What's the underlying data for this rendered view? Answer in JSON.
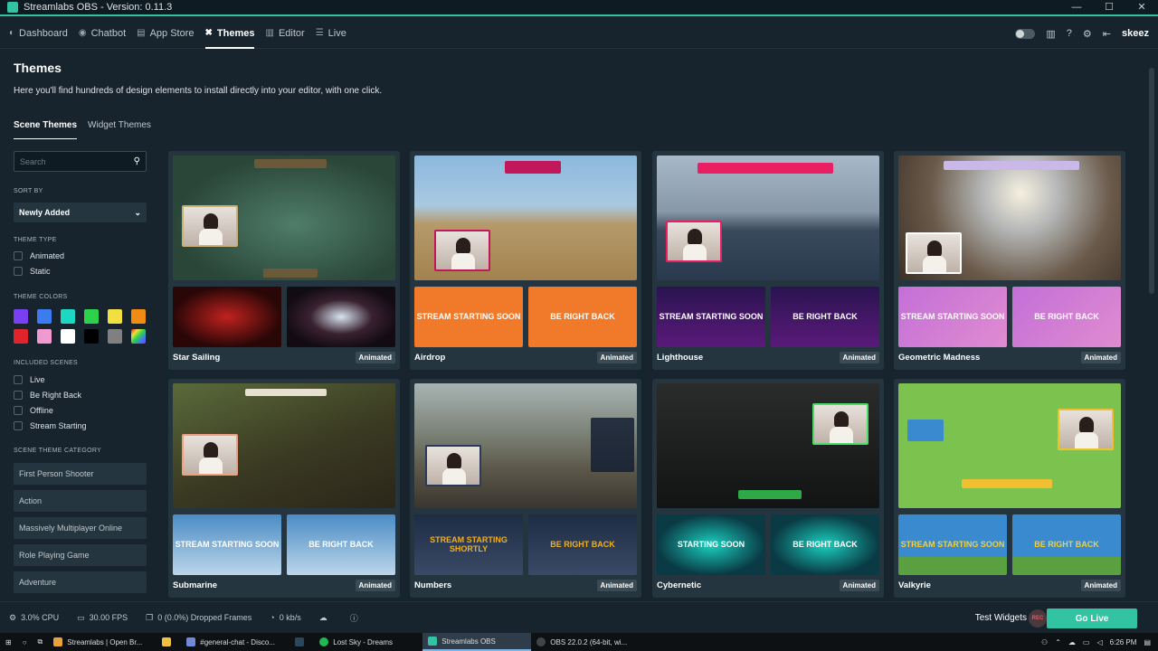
{
  "window": {
    "title": "Streamlabs OBS - Version: 0.11.3",
    "controls": [
      "—",
      "☐",
      "✕"
    ]
  },
  "nav": {
    "items": [
      {
        "label": "Dashboard",
        "icon": "dashboard-icon",
        "glyph": "◐"
      },
      {
        "label": "Chatbot",
        "icon": "chatbot-icon",
        "glyph": "◉"
      },
      {
        "label": "App Store",
        "icon": "store-icon",
        "glyph": "▤"
      },
      {
        "label": "Themes",
        "icon": "themes-icon",
        "glyph": "✖",
        "active": true
      },
      {
        "label": "Editor",
        "icon": "editor-icon",
        "glyph": "▥"
      },
      {
        "label": "Live",
        "icon": "live-icon",
        "glyph": "☰"
      }
    ],
    "user": "skeez"
  },
  "page": {
    "title": "Themes",
    "description": "Here you'll find hundreds of design elements to install directly into your editor, with one click.",
    "tabs": [
      "Scene Themes",
      "Widget Themes"
    ]
  },
  "sidebar": {
    "search_placeholder": "Search",
    "sort_label": "SORT BY",
    "sort_value": "Newly Added",
    "type_label": "THEME TYPE",
    "types": [
      "Animated",
      "Static"
    ],
    "colors_label": "THEME COLORS",
    "colors": [
      "#7b3ff2",
      "#3d7bf0",
      "#1ed7c1",
      "#2ed14a",
      "#f0e040",
      "#f08c14",
      "#e0242c",
      "#f09ad0",
      "#ffffff",
      "#000000",
      "#808080",
      "rainbow"
    ],
    "scenes_label": "INCLUDED SCENES",
    "scenes": [
      "Live",
      "Be Right Back",
      "Offline",
      "Stream Starting"
    ],
    "category_label": "SCENE THEME CATEGORY",
    "categories": [
      "First Person Shooter",
      "Action",
      "Massively Multiplayer Online",
      "Role Playing Game",
      "Adventure"
    ]
  },
  "themes": [
    {
      "name": "Star Sailing",
      "badge": "Animated",
      "thumbs": [
        "",
        ""
      ]
    },
    {
      "name": "Airdrop",
      "badge": "Animated",
      "thumbs": [
        "STREAM STARTING SOON",
        "BE RIGHT BACK"
      ]
    },
    {
      "name": "Lighthouse",
      "badge": "Animated",
      "thumbs": [
        "STREAM STARTING SOON",
        "BE RIGHT BACK"
      ]
    },
    {
      "name": "Geometric Madness",
      "badge": "Animated",
      "thumbs": [
        "STREAM STARTING SOON",
        "BE RIGHT BACK"
      ]
    },
    {
      "name": "Submarine",
      "badge": "Animated",
      "thumbs": [
        "STREAM STARTING SOON",
        "BE RIGHT BACK"
      ]
    },
    {
      "name": "Numbers",
      "badge": "Animated",
      "thumbs": [
        "STREAM STARTING SHORTLY",
        "BE RIGHT BACK"
      ]
    },
    {
      "name": "Cybernetic",
      "badge": "Animated",
      "thumbs": [
        "STARTING SOON",
        "BE RIGHT BACK"
      ]
    },
    {
      "name": "Valkyrie",
      "badge": "Animated",
      "thumbs": [
        "STREAM STARTING SOON",
        "BE RIGHT BACK"
      ]
    }
  ],
  "status": {
    "cpu": "3.0% CPU",
    "fps": "30.00 FPS",
    "dropped": "0 (0.0%) Dropped Frames",
    "bitrate": "0 kb/s",
    "test_widgets": "Test Widgets",
    "rec": "REC",
    "go_live": "Go Live"
  },
  "taskbar": {
    "tasks": [
      {
        "label": "Streamlabs | Open Br...",
        "color": "#e8a33c"
      },
      {
        "label": "#general-chat - Disco...",
        "color": "#7289da"
      },
      {
        "label": "Lost Sky - Dreams",
        "color": "#1db954"
      },
      {
        "label": "Streamlabs OBS",
        "color": "#31c3a2",
        "active": true
      },
      {
        "label": "OBS 22.0.2 (64-bit, wi...",
        "color": "#444444"
      }
    ],
    "time": "6:26 PM"
  }
}
